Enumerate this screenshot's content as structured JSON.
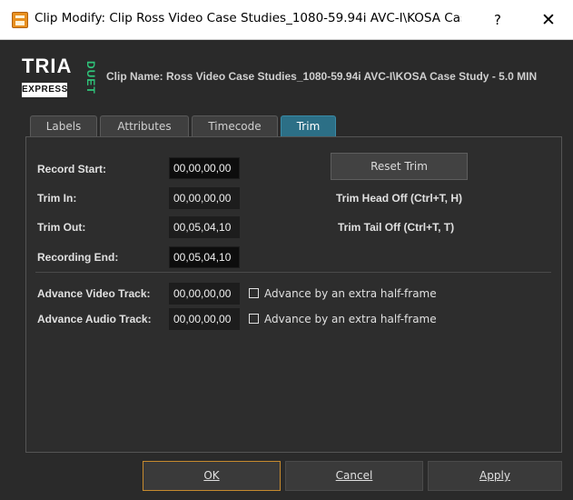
{
  "window": {
    "title": "Clip Modify: Clip Ross Video Case Studies_1080-59.94i AVC-I\\KOSA Case ...",
    "help_label": "?",
    "close_label": "✕"
  },
  "header": {
    "logo_main": "TRIA",
    "logo_sub": "EXPRESS",
    "logo_side": "DUET",
    "clip_name": "Clip Name: Ross Video Case Studies_1080-59.94i AVC-I\\KOSA Case Study - 5.0 MIN"
  },
  "tabs": [
    {
      "label": "Labels"
    },
    {
      "label": "Attributes"
    },
    {
      "label": "Timecode"
    },
    {
      "label": "Trim",
      "active": true
    }
  ],
  "trim": {
    "record_start": {
      "label": "Record Start:",
      "value": "00,00,00,00"
    },
    "trim_in": {
      "label": "Trim In:",
      "value": "00,00,00,00"
    },
    "trim_out": {
      "label": "Trim Out:",
      "value": "00,05,04,10"
    },
    "recording_end": {
      "label": "Recording End:",
      "value": "00,05,04,10"
    },
    "reset_trim_label": "Reset Trim",
    "trim_head_off": "Trim Head Off (Ctrl+T, H)",
    "trim_tail_off": "Trim Tail Off (Ctrl+T, T)",
    "advance_video": {
      "label": "Advance Video Track:",
      "value": "00,00,00,00",
      "checkbox_label": "Advance by an extra half-frame",
      "checked": false
    },
    "advance_audio": {
      "label": "Advance Audio Track:",
      "value": "00,00,00,00",
      "checkbox_label": "Advance by an extra half-frame",
      "checked": false
    }
  },
  "buttons": {
    "ok_label": "OK",
    "cancel_label": "Cancel",
    "apply_label": "Apply"
  },
  "colors": {
    "active_tab": "#2c6f86",
    "default_button_border": "#c68a2e",
    "duet_green": "#2fc47a",
    "background": "#2a2a2a"
  }
}
